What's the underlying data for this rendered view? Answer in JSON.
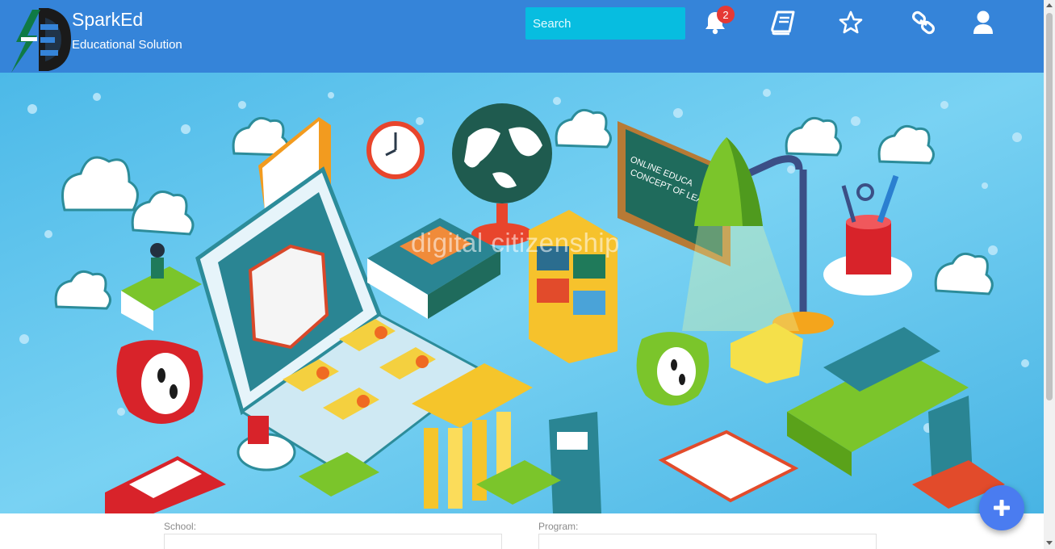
{
  "header": {
    "brand_name": "SparkEd",
    "brand_tagline": "Educational Solution",
    "logo_letters": "S-ED",
    "search_placeholder": "Search",
    "notification_count": "2",
    "nav_icons": [
      "bell-icon",
      "book-icon",
      "star-icon",
      "link-icon",
      "user-icon"
    ],
    "color": "#3584d9",
    "search_color": "#07bde0"
  },
  "hero": {
    "title": "digital citizenship",
    "background": "#5cc8ef"
  },
  "form": {
    "school_label": "School:",
    "program_label": "Program:"
  },
  "fab": {
    "icon": "plus-icon",
    "color": "#4a7cf0"
  }
}
